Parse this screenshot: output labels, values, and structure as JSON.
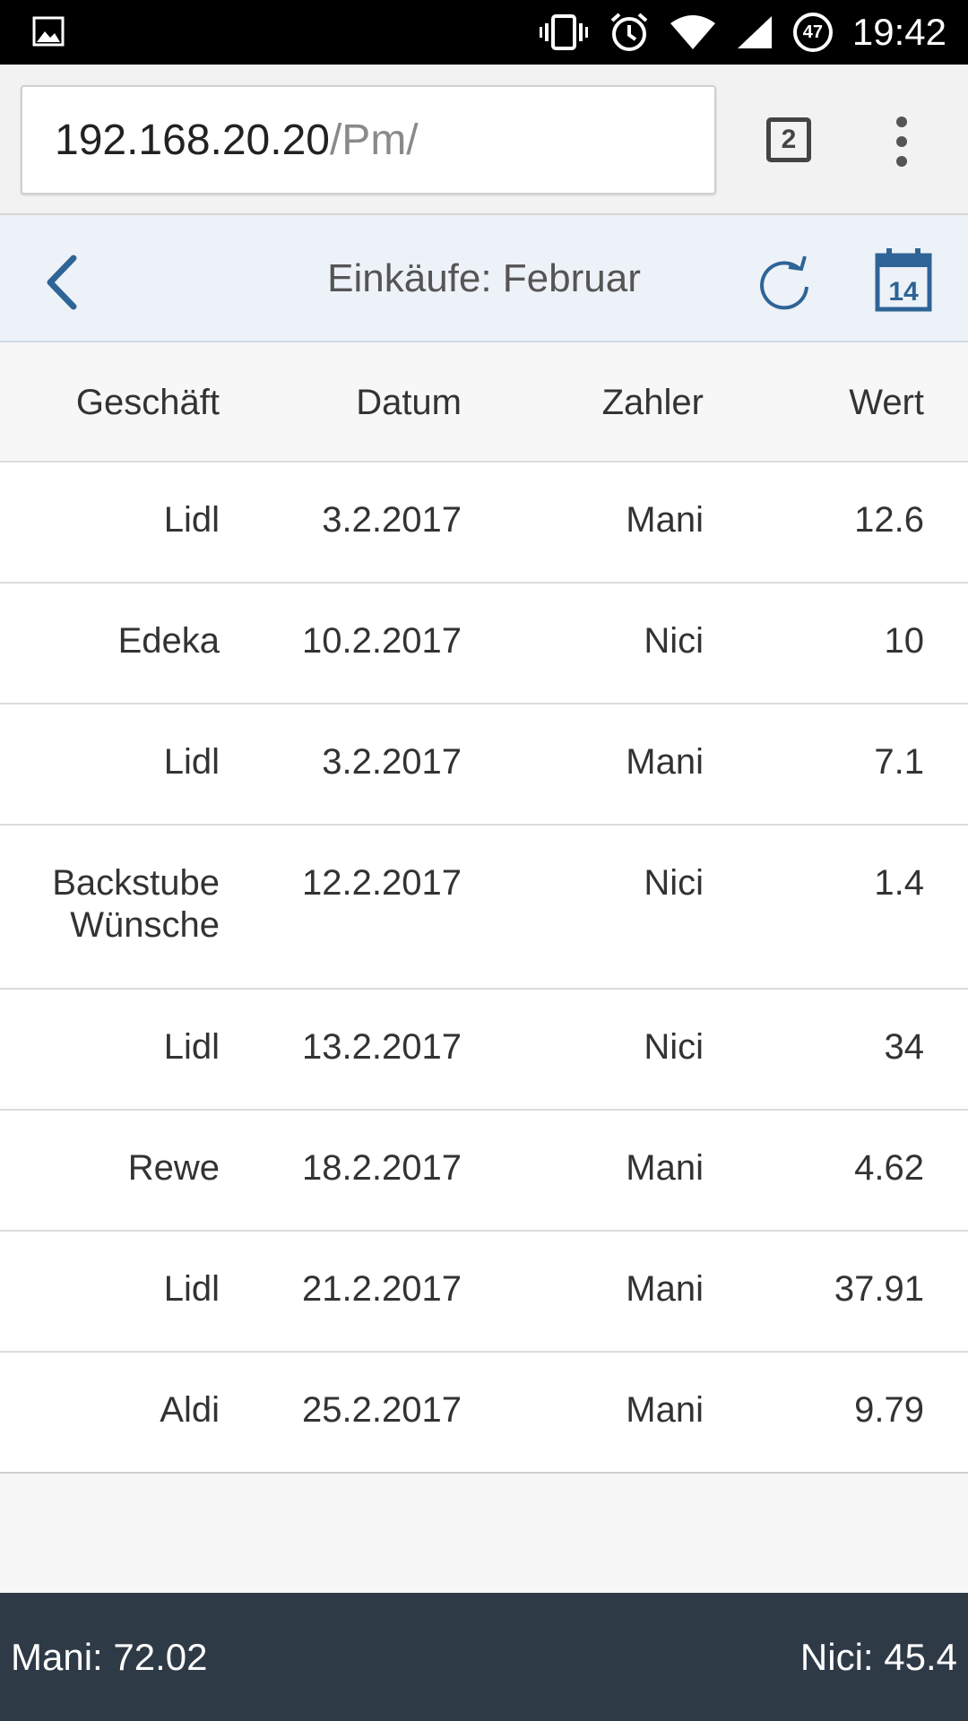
{
  "status_bar": {
    "time": "19:42",
    "battery": "47",
    "icons": [
      "image-icon",
      "vibrate-icon",
      "alarm-icon",
      "wifi-icon",
      "signal-icon",
      "battery-icon"
    ]
  },
  "browser": {
    "url_host": "192.168.20.20",
    "url_path": "/Pm/",
    "tab_count": "2"
  },
  "header": {
    "title": "Einkäufe: Februar",
    "calendar_day": "14",
    "accent_color": "#2e6496"
  },
  "table": {
    "columns": [
      "Geschäft",
      "Datum",
      "Zahler",
      "Wert"
    ],
    "rows": [
      {
        "shop": "Lidl",
        "date": "3.2.2017",
        "payer": "Mani",
        "value": "12.6"
      },
      {
        "shop": "Edeka",
        "date": "10.2.2017",
        "payer": "Nici",
        "value": "10"
      },
      {
        "shop": "Lidl",
        "date": "3.2.2017",
        "payer": "Mani",
        "value": "7.1"
      },
      {
        "shop": "Backstube Wünsche",
        "date": "12.2.2017",
        "payer": "Nici",
        "value": "1.4"
      },
      {
        "shop": "Lidl",
        "date": "13.2.2017",
        "payer": "Nici",
        "value": "34"
      },
      {
        "shop": "Rewe",
        "date": "18.2.2017",
        "payer": "Mani",
        "value": "4.62"
      },
      {
        "shop": "Lidl",
        "date": "21.2.2017",
        "payer": "Mani",
        "value": "37.91"
      },
      {
        "shop": "Aldi",
        "date": "25.2.2017",
        "payer": "Mani",
        "value": "9.79"
      }
    ]
  },
  "footer": {
    "left_sum": "Mani: 72.02",
    "right_sum": "Nici: 45.4"
  }
}
